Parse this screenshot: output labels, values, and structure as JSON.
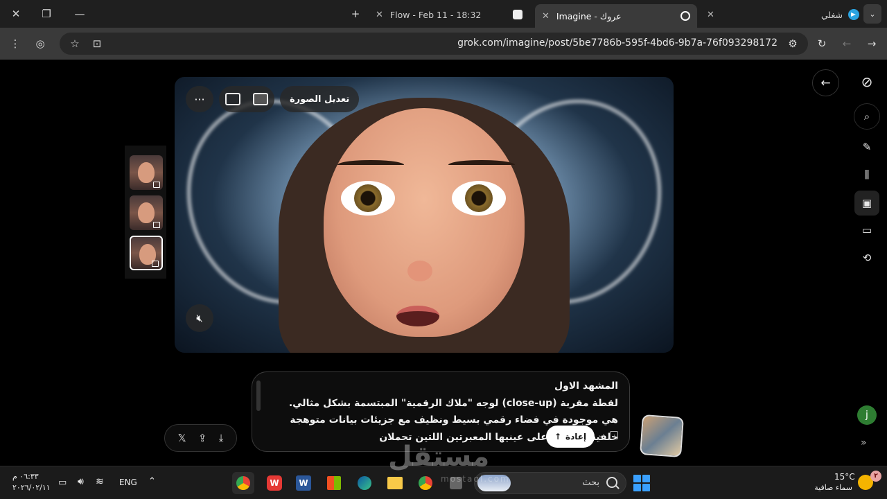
{
  "browser": {
    "tabs": [
      {
        "label": "Flow - Feb 11 - 18:32"
      },
      {
        "label": "Imagine - عروك"
      },
      {
        "label": "شغلي"
      }
    ],
    "url": "grok.com/imagine/post/5be7786b-595f-4bd6-9b7a-76f093298172"
  },
  "image_toolbar": {
    "edit_label": "تعديل الصورة",
    "more": "···"
  },
  "prompt": {
    "lines": [
      "المشهد الاول",
      "لقطة مقربة (close-up) لوجه \"ملاك الرقمية\" المبتسمة بشكل مثالي.",
      "هي موجودة في فضاء رقمي بسيط ونظيف مع جزيئات بيانات متوهجة",
      "خلفية. التركيز على عينيها المعبرتين اللتين تحملان"
    ],
    "redo_label": "إعادة"
  },
  "user": {
    "initial": "j"
  },
  "watermark": {
    "text": "مستقل",
    "sub": "mostaql.com"
  },
  "taskbar": {
    "time": "٠٦:٣٣ م",
    "date": "٢٠٢٦/٠٢/١١",
    "lang": "ENG",
    "search_label": "بحث",
    "weather_temp": "15°C",
    "weather_desc": "سماء صافية",
    "weather_badge": "٢"
  },
  "colors": {
    "accent": "#3aa0ff",
    "user_avatar": "#2e7d32"
  }
}
